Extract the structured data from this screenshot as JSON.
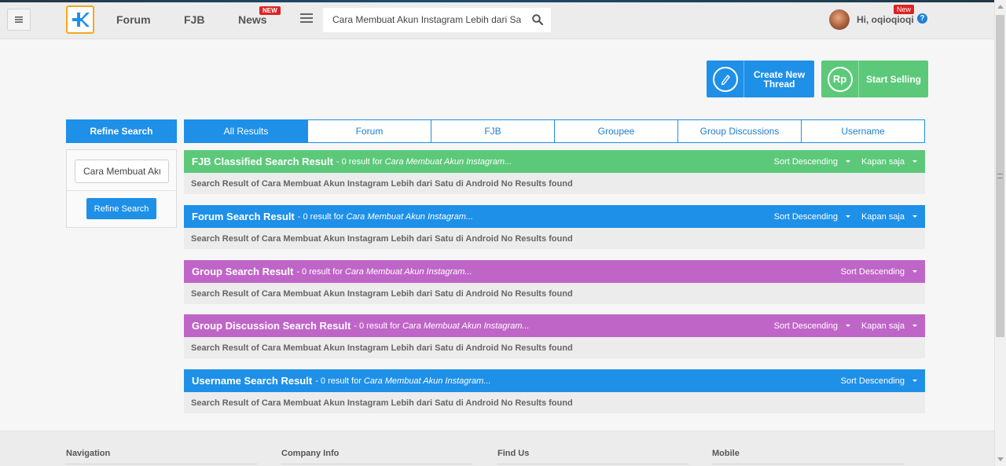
{
  "header": {
    "nav": [
      {
        "label": "Forum"
      },
      {
        "label": "FJB"
      },
      {
        "label": "News",
        "badge": "NEW"
      }
    ],
    "search": {
      "value": "Cara Membuat Akun Instagram Lebih dari Sat"
    },
    "user": {
      "greeting": "Hi, oqioqioqi",
      "badge": "New"
    },
    "help": "?"
  },
  "actions": {
    "create_thread": "Create New Thread",
    "start_selling": "Start Selling",
    "rp": "Rp"
  },
  "sidebar": {
    "title": "Refine Search",
    "input_value": "Cara Membuat Akun",
    "button": "Refine Search"
  },
  "tabs": [
    "All Results",
    "Forum",
    "FJB",
    "Groupee",
    "Group Discussions",
    "Username"
  ],
  "results": [
    {
      "title": "FJB Classified Search Result",
      "meta": "- 0 result for",
      "query": "Cara Membuat Akun Instagram...",
      "sort": "Sort Descending",
      "time": "Kapan saja",
      "body": "Search Result of Cara Membuat Akun Instagram Lebih dari Satu di Android No Results found",
      "color": "#5cc97a"
    },
    {
      "title": "Forum Search Result",
      "meta": "- 0 result for",
      "query": "Cara Membuat Akun Instagram...",
      "sort": "Sort Descending",
      "time": "Kapan saja",
      "body": "Search Result of Cara Membuat Akun Instagram Lebih dari Satu di Android No Results found",
      "color": "#1e90e8"
    },
    {
      "title": "Group Search Result",
      "meta": "- 0 result for",
      "query": "Cara Membuat Akun Instagram...",
      "sort": "Sort Descending",
      "body": "Search Result of Cara Membuat Akun Instagram Lebih dari Satu di Android No Results found",
      "color": "#c065c8"
    },
    {
      "title": "Group Discussion Search Result",
      "meta": "- 0 result for",
      "query": "Cara Membuat Akun Instagram...",
      "sort": "Sort Descending",
      "time": "Kapan saja",
      "body": "Search Result of Cara Membuat Akun Instagram Lebih dari Satu di Android No Results found",
      "color": "#c065c8"
    },
    {
      "title": "Username Search Result",
      "meta": "- 0 result for",
      "query": "Cara Membuat Akun Instagram...",
      "sort": "Sort Descending",
      "body": "Search Result of Cara Membuat Akun Instagram Lebih dari Satu di Android No Results found",
      "color": "#1e90e8"
    }
  ],
  "footer": [
    "Navigation",
    "Company Info",
    "Find Us",
    "Mobile"
  ]
}
